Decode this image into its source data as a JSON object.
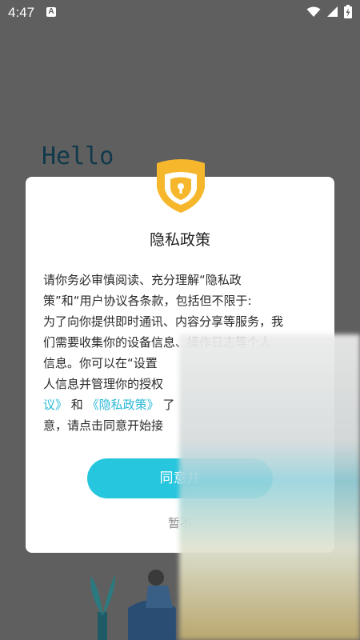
{
  "status_bar": {
    "time": "4:47",
    "badge": "A",
    "icons": [
      "wifi-icon",
      "signal-icon",
      "battery-charging-icon"
    ]
  },
  "background": {
    "hello_text": "Hello"
  },
  "dialog": {
    "title": "隐私政策",
    "body_lines": [
      "请你务必审慎阅读、充分理解“隐私政",
      "策”和“用户协议各条款，包括但不限于:",
      "为了向你提供即时通讯、内容分享等服务，我",
      "们需要收集你的设备信息、操作日志等个人",
      "信息。你可以在“设置"
    ],
    "line6": "人信息并管理你的授权",
    "line7_link_a": "议》",
    "line7_and": "和",
    "line7_link_b": "《隐私政策》",
    "line7_end": "了",
    "line8": "意，请点击同意开始接",
    "agree_button": "同意并",
    "decline_button": "暂不"
  },
  "colors": {
    "accent": "#26c6de",
    "link": "#28b9d6",
    "shield": "#f6b72d",
    "dim_background": "#5f5f5f"
  }
}
